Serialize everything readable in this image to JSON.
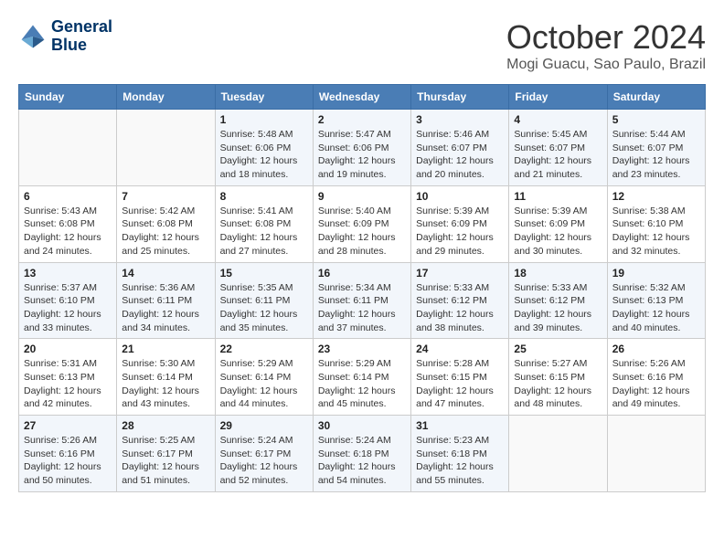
{
  "logo": {
    "line1": "General",
    "line2": "Blue"
  },
  "title": "October 2024",
  "location": "Mogi Guacu, Sao Paulo, Brazil",
  "days_of_week": [
    "Sunday",
    "Monday",
    "Tuesday",
    "Wednesday",
    "Thursday",
    "Friday",
    "Saturday"
  ],
  "weeks": [
    [
      {
        "day": null,
        "sunrise": null,
        "sunset": null,
        "daylight": null
      },
      {
        "day": null,
        "sunrise": null,
        "sunset": null,
        "daylight": null
      },
      {
        "day": "1",
        "sunrise": "Sunrise: 5:48 AM",
        "sunset": "Sunset: 6:06 PM",
        "daylight": "Daylight: 12 hours and 18 minutes."
      },
      {
        "day": "2",
        "sunrise": "Sunrise: 5:47 AM",
        "sunset": "Sunset: 6:06 PM",
        "daylight": "Daylight: 12 hours and 19 minutes."
      },
      {
        "day": "3",
        "sunrise": "Sunrise: 5:46 AM",
        "sunset": "Sunset: 6:07 PM",
        "daylight": "Daylight: 12 hours and 20 minutes."
      },
      {
        "day": "4",
        "sunrise": "Sunrise: 5:45 AM",
        "sunset": "Sunset: 6:07 PM",
        "daylight": "Daylight: 12 hours and 21 minutes."
      },
      {
        "day": "5",
        "sunrise": "Sunrise: 5:44 AM",
        "sunset": "Sunset: 6:07 PM",
        "daylight": "Daylight: 12 hours and 23 minutes."
      }
    ],
    [
      {
        "day": "6",
        "sunrise": "Sunrise: 5:43 AM",
        "sunset": "Sunset: 6:08 PM",
        "daylight": "Daylight: 12 hours and 24 minutes."
      },
      {
        "day": "7",
        "sunrise": "Sunrise: 5:42 AM",
        "sunset": "Sunset: 6:08 PM",
        "daylight": "Daylight: 12 hours and 25 minutes."
      },
      {
        "day": "8",
        "sunrise": "Sunrise: 5:41 AM",
        "sunset": "Sunset: 6:08 PM",
        "daylight": "Daylight: 12 hours and 27 minutes."
      },
      {
        "day": "9",
        "sunrise": "Sunrise: 5:40 AM",
        "sunset": "Sunset: 6:09 PM",
        "daylight": "Daylight: 12 hours and 28 minutes."
      },
      {
        "day": "10",
        "sunrise": "Sunrise: 5:39 AM",
        "sunset": "Sunset: 6:09 PM",
        "daylight": "Daylight: 12 hours and 29 minutes."
      },
      {
        "day": "11",
        "sunrise": "Sunrise: 5:39 AM",
        "sunset": "Sunset: 6:09 PM",
        "daylight": "Daylight: 12 hours and 30 minutes."
      },
      {
        "day": "12",
        "sunrise": "Sunrise: 5:38 AM",
        "sunset": "Sunset: 6:10 PM",
        "daylight": "Daylight: 12 hours and 32 minutes."
      }
    ],
    [
      {
        "day": "13",
        "sunrise": "Sunrise: 5:37 AM",
        "sunset": "Sunset: 6:10 PM",
        "daylight": "Daylight: 12 hours and 33 minutes."
      },
      {
        "day": "14",
        "sunrise": "Sunrise: 5:36 AM",
        "sunset": "Sunset: 6:11 PM",
        "daylight": "Daylight: 12 hours and 34 minutes."
      },
      {
        "day": "15",
        "sunrise": "Sunrise: 5:35 AM",
        "sunset": "Sunset: 6:11 PM",
        "daylight": "Daylight: 12 hours and 35 minutes."
      },
      {
        "day": "16",
        "sunrise": "Sunrise: 5:34 AM",
        "sunset": "Sunset: 6:11 PM",
        "daylight": "Daylight: 12 hours and 37 minutes."
      },
      {
        "day": "17",
        "sunrise": "Sunrise: 5:33 AM",
        "sunset": "Sunset: 6:12 PM",
        "daylight": "Daylight: 12 hours and 38 minutes."
      },
      {
        "day": "18",
        "sunrise": "Sunrise: 5:33 AM",
        "sunset": "Sunset: 6:12 PM",
        "daylight": "Daylight: 12 hours and 39 minutes."
      },
      {
        "day": "19",
        "sunrise": "Sunrise: 5:32 AM",
        "sunset": "Sunset: 6:13 PM",
        "daylight": "Daylight: 12 hours and 40 minutes."
      }
    ],
    [
      {
        "day": "20",
        "sunrise": "Sunrise: 5:31 AM",
        "sunset": "Sunset: 6:13 PM",
        "daylight": "Daylight: 12 hours and 42 minutes."
      },
      {
        "day": "21",
        "sunrise": "Sunrise: 5:30 AM",
        "sunset": "Sunset: 6:14 PM",
        "daylight": "Daylight: 12 hours and 43 minutes."
      },
      {
        "day": "22",
        "sunrise": "Sunrise: 5:29 AM",
        "sunset": "Sunset: 6:14 PM",
        "daylight": "Daylight: 12 hours and 44 minutes."
      },
      {
        "day": "23",
        "sunrise": "Sunrise: 5:29 AM",
        "sunset": "Sunset: 6:14 PM",
        "daylight": "Daylight: 12 hours and 45 minutes."
      },
      {
        "day": "24",
        "sunrise": "Sunrise: 5:28 AM",
        "sunset": "Sunset: 6:15 PM",
        "daylight": "Daylight: 12 hours and 47 minutes."
      },
      {
        "day": "25",
        "sunrise": "Sunrise: 5:27 AM",
        "sunset": "Sunset: 6:15 PM",
        "daylight": "Daylight: 12 hours and 48 minutes."
      },
      {
        "day": "26",
        "sunrise": "Sunrise: 5:26 AM",
        "sunset": "Sunset: 6:16 PM",
        "daylight": "Daylight: 12 hours and 49 minutes."
      }
    ],
    [
      {
        "day": "27",
        "sunrise": "Sunrise: 5:26 AM",
        "sunset": "Sunset: 6:16 PM",
        "daylight": "Daylight: 12 hours and 50 minutes."
      },
      {
        "day": "28",
        "sunrise": "Sunrise: 5:25 AM",
        "sunset": "Sunset: 6:17 PM",
        "daylight": "Daylight: 12 hours and 51 minutes."
      },
      {
        "day": "29",
        "sunrise": "Sunrise: 5:24 AM",
        "sunset": "Sunset: 6:17 PM",
        "daylight": "Daylight: 12 hours and 52 minutes."
      },
      {
        "day": "30",
        "sunrise": "Sunrise: 5:24 AM",
        "sunset": "Sunset: 6:18 PM",
        "daylight": "Daylight: 12 hours and 54 minutes."
      },
      {
        "day": "31",
        "sunrise": "Sunrise: 5:23 AM",
        "sunset": "Sunset: 6:18 PM",
        "daylight": "Daylight: 12 hours and 55 minutes."
      },
      {
        "day": null,
        "sunrise": null,
        "sunset": null,
        "daylight": null
      },
      {
        "day": null,
        "sunrise": null,
        "sunset": null,
        "daylight": null
      }
    ]
  ]
}
